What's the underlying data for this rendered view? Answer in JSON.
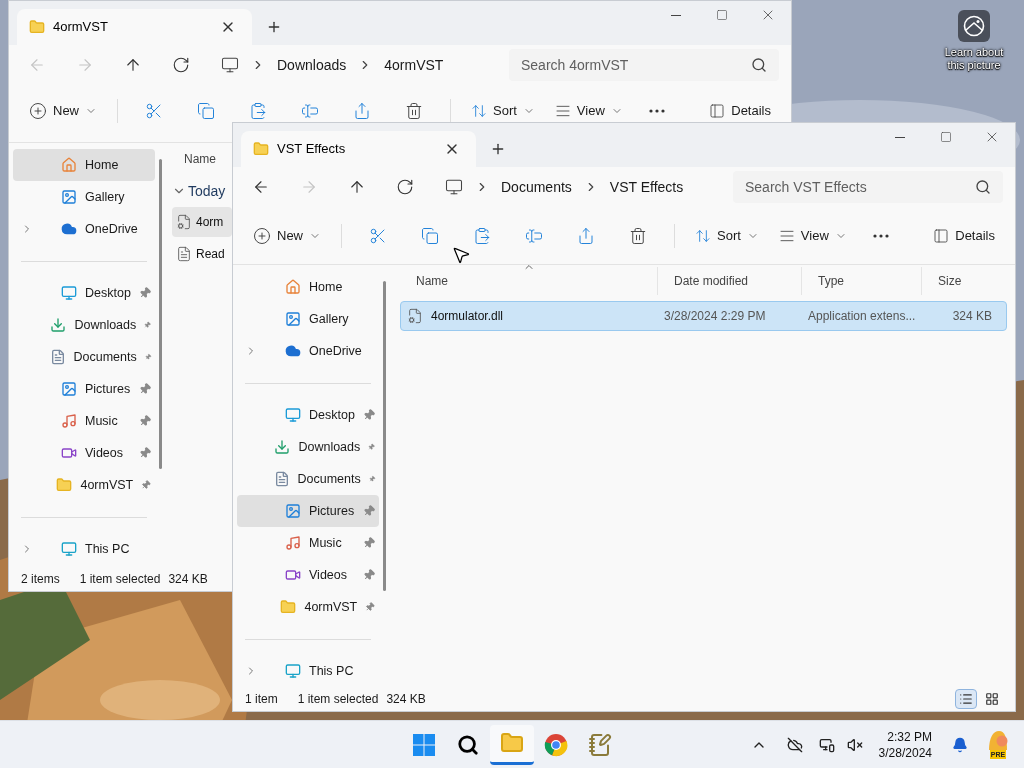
{
  "desktop": {
    "spotlight_label": "Learn about this picture"
  },
  "windows": [
    {
      "tab_title": "4ormVST",
      "breadcrumb": [
        "Downloads",
        "4ormVST"
      ],
      "search_placeholder": "Search 4ormVST",
      "nav": [
        {
          "kind": "back",
          "disabled": true
        },
        {
          "kind": "forward",
          "disabled": true
        },
        {
          "kind": "up",
          "disabled": false
        },
        {
          "kind": "refresh",
          "disabled": false
        }
      ],
      "toolbar": {
        "new": "New",
        "sort": "Sort",
        "view": "View",
        "details": "Details"
      },
      "sidebar": [
        {
          "kind": "home",
          "label": "Home",
          "selected": true,
          "pinned": false,
          "expandable": false
        },
        {
          "kind": "gallery",
          "label": "Gallery",
          "selected": false,
          "pinned": false,
          "expandable": false
        },
        {
          "kind": "onedrive",
          "label": "OneDrive",
          "selected": false,
          "pinned": false,
          "expandable": true
        },
        {
          "kind": "divider"
        },
        {
          "kind": "desktop",
          "label": "Desktop",
          "selected": false,
          "pinned": true,
          "expandable": false
        },
        {
          "kind": "downloads",
          "label": "Downloads",
          "selected": false,
          "pinned": true,
          "expandable": false
        },
        {
          "kind": "documents",
          "label": "Documents",
          "selected": false,
          "pinned": true,
          "expandable": false
        },
        {
          "kind": "pictures",
          "label": "Pictures",
          "selected": false,
          "pinned": true,
          "expandable": false
        },
        {
          "kind": "music",
          "label": "Music",
          "selected": false,
          "pinned": true,
          "expandable": false
        },
        {
          "kind": "videos",
          "label": "Videos",
          "selected": false,
          "pinned": true,
          "expandable": false
        },
        {
          "kind": "folder",
          "label": "4ormVST",
          "selected": false,
          "pinned": true,
          "expandable": false
        },
        {
          "kind": "divider"
        },
        {
          "kind": "pc",
          "label": "This PC",
          "selected": false,
          "pinned": false,
          "expandable": true
        }
      ],
      "columns": [
        {
          "label": "Name"
        }
      ],
      "group": {
        "label": "Today",
        "expanded": true
      },
      "files": [
        {
          "kind": "dll",
          "cells": [
            "4orm"
          ],
          "selected": true
        },
        {
          "kind": "text",
          "cells": [
            "Read"
          ],
          "selected": false
        }
      ],
      "status": {
        "count": "2 items",
        "selection": "1 item selected",
        "size": "324 KB"
      }
    },
    {
      "tab_title": "VST Effects",
      "breadcrumb": [
        "Documents",
        "VST Effects"
      ],
      "search_placeholder": "Search VST Effects",
      "nav": [
        {
          "kind": "back",
          "disabled": false
        },
        {
          "kind": "forward",
          "disabled": true
        },
        {
          "kind": "up",
          "disabled": false
        },
        {
          "kind": "refresh",
          "disabled": false
        }
      ],
      "toolbar": {
        "new": "New",
        "sort": "Sort",
        "view": "View",
        "details": "Details"
      },
      "sidebar": [
        {
          "kind": "home",
          "label": "Home",
          "selected": false,
          "pinned": false,
          "expandable": false
        },
        {
          "kind": "gallery",
          "label": "Gallery",
          "selected": false,
          "pinned": false,
          "expandable": false
        },
        {
          "kind": "onedrive",
          "label": "OneDrive",
          "selected": false,
          "pinned": false,
          "expandable": true
        },
        {
          "kind": "divider"
        },
        {
          "kind": "desktop",
          "label": "Desktop",
          "selected": false,
          "pinned": true,
          "expandable": false
        },
        {
          "kind": "downloads",
          "label": "Downloads",
          "selected": false,
          "pinned": true,
          "expandable": false
        },
        {
          "kind": "documents",
          "label": "Documents",
          "selected": false,
          "pinned": true,
          "expandable": false
        },
        {
          "kind": "pictures",
          "label": "Pictures",
          "selected": true,
          "pinned": true,
          "expandable": false
        },
        {
          "kind": "music",
          "label": "Music",
          "selected": false,
          "pinned": true,
          "expandable": false
        },
        {
          "kind": "videos",
          "label": "Videos",
          "selected": false,
          "pinned": true,
          "expandable": false
        },
        {
          "kind": "folder",
          "label": "4ormVST",
          "selected": false,
          "pinned": true,
          "expandable": false
        },
        {
          "kind": "divider"
        },
        {
          "kind": "pc",
          "label": "This PC",
          "selected": false,
          "pinned": false,
          "expandable": true
        }
      ],
      "columns": [
        {
          "label": "Name",
          "sorted": true
        },
        {
          "label": "Date modified",
          "sorted": false
        },
        {
          "label": "Type",
          "sorted": false
        },
        {
          "label": "Size",
          "sorted": false
        }
      ],
      "files": [
        {
          "kind": "dll",
          "cells": [
            "4ormulator.dll",
            "3/28/2024 2:29 PM",
            "Application extens...",
            "324 KB"
          ],
          "selected": true
        }
      ],
      "status": {
        "count": "1 item",
        "selection": "1 item selected",
        "size": "324 KB"
      },
      "view_modes": [
        {
          "kind": "details",
          "selected": true
        },
        {
          "kind": "tiles",
          "selected": false
        }
      ]
    }
  ],
  "taskbar": {
    "apps": [
      {
        "kind": "start",
        "selected": false
      },
      {
        "kind": "search",
        "selected": false
      },
      {
        "kind": "explorer",
        "selected": true
      },
      {
        "kind": "browser",
        "selected": false
      },
      {
        "kind": "notepad",
        "selected": false
      }
    ],
    "time": "2:32 PM",
    "date": "3/28/2024",
    "badge": "PRE"
  }
}
